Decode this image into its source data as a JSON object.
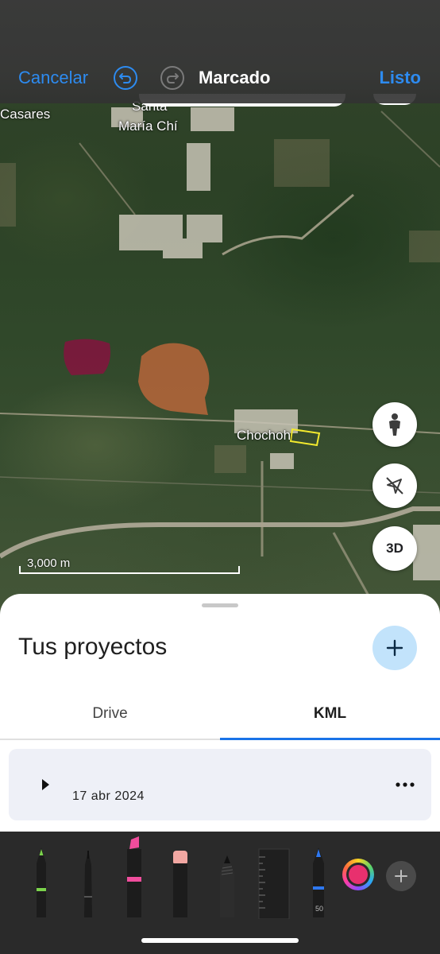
{
  "header": {
    "cancel_label": "Cancelar",
    "title": "Marcado",
    "done_label": "Listo"
  },
  "map": {
    "labels": {
      "town_left": "Casares",
      "town_top_line1": "Santa",
      "town_top_line2": "María Chí",
      "village": "Chochoh"
    },
    "scale_label": "3,000 m",
    "btn_3d_label": "3D"
  },
  "sheet": {
    "title": "Tus proyectos",
    "tabs": [
      {
        "label": "Drive",
        "active": false
      },
      {
        "label": "KML",
        "active": true
      }
    ],
    "project": {
      "date": "17 abr 2024"
    }
  },
  "toolbar": {
    "tools": [
      "pen-tool-icon",
      "fineliner-tool-icon",
      "marker-tool-icon",
      "eraser-tool-icon",
      "pencil-tool-icon",
      "ruler-tool-icon",
      "blue-pen-tool-icon"
    ],
    "width_label": "50",
    "selected_color": "#e8306e"
  },
  "colors": {
    "accent": "#2d8bf0",
    "tab_indicator": "#1a73e8",
    "fab_bg": "#c2e3fb"
  }
}
